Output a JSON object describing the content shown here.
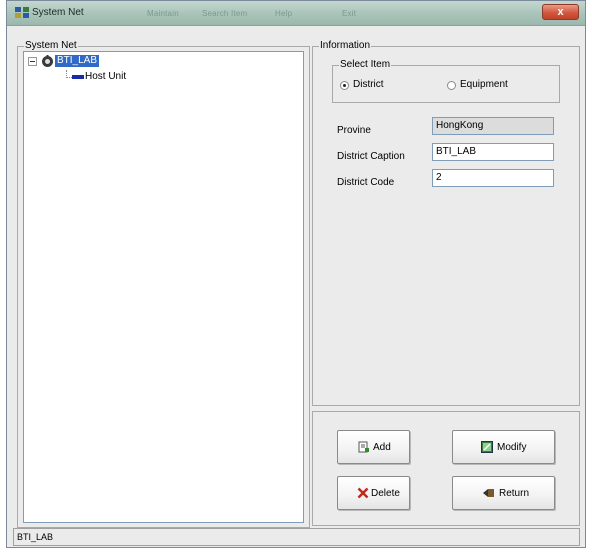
{
  "window": {
    "title": "System Net",
    "blurred_menu": [
      "Maintain",
      "Search Item",
      "Help",
      "Exit"
    ],
    "close_label": "x"
  },
  "tree": {
    "group_label": "System Net",
    "root": {
      "label": "BTI_LAB",
      "icon": "district-icon"
    },
    "child": {
      "label": "Host Unit",
      "icon": "host-unit-icon"
    }
  },
  "info": {
    "group_label": "Information",
    "select_item": {
      "label": "Select Item",
      "options": [
        "District",
        "Equipment"
      ],
      "selected": "District"
    },
    "fields": [
      {
        "label": "Provine",
        "value": "HongKong",
        "readonly": true
      },
      {
        "label": "District Caption",
        "value": "BTI_LAB",
        "readonly": false
      },
      {
        "label": "District Code",
        "value": "2",
        "readonly": false
      }
    ]
  },
  "buttons": {
    "add": "Add",
    "modify": "Modify",
    "delete": "Delete",
    "return": "Return"
  },
  "status": {
    "text": "BTI_LAB"
  },
  "colors": {
    "selection": "#3169c6",
    "titlebar": "#a9c3b9",
    "delete_icon": "#c0281c"
  }
}
